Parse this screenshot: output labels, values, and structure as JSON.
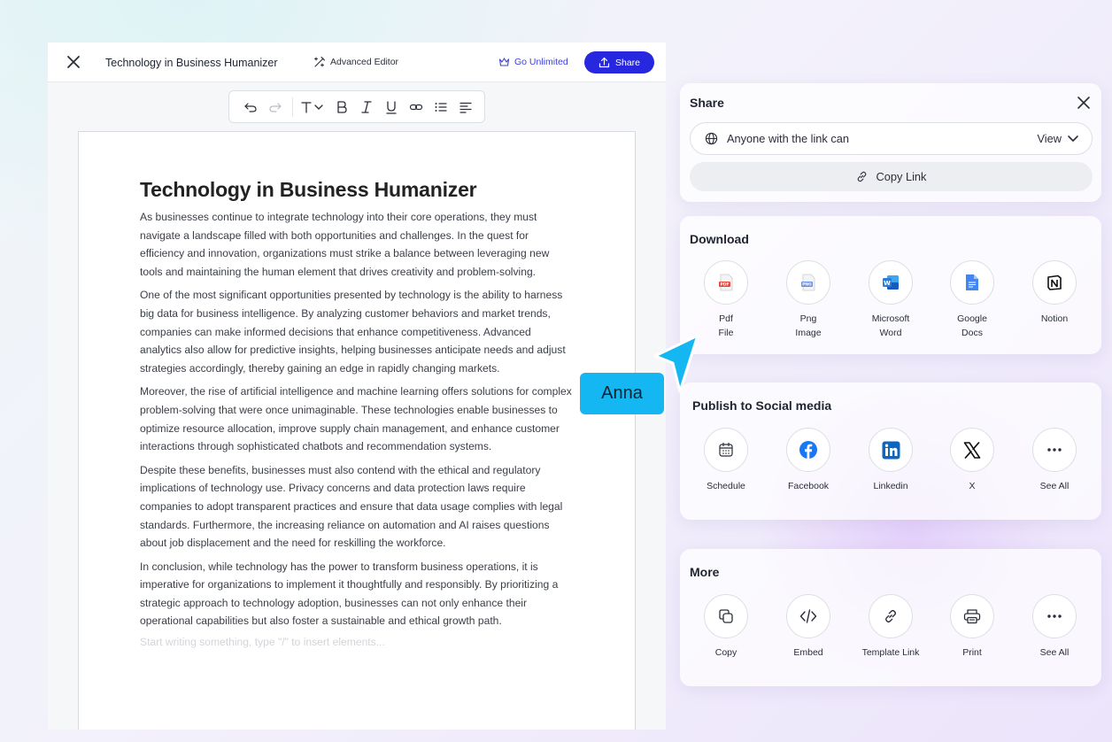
{
  "editor": {
    "doc_name": "Technology in Business Humanizer",
    "advanced_editor_label": "Advanced Editor",
    "go_unlimited_label": "Go Unlimited",
    "share_label": "Share",
    "accent": "#2727e0"
  },
  "toolbar": {
    "icons": [
      "undo-icon",
      "redo-icon",
      "text-style-icon",
      "bold-icon",
      "italic-icon",
      "underline-icon",
      "link-icon",
      "bullet-list-icon",
      "align-left-icon"
    ]
  },
  "document": {
    "title": "Technology in Business Humanizer",
    "paragraphs": [
      "As businesses continue to integrate technology into their core operations, they must navigate a landscape filled with both opportunities and challenges. In the quest for efficiency and innovation, organizations must strike a balance between leveraging new tools and maintaining the human element that drives creativity and problem-solving.",
      "One of the most significant opportunities presented by technology is the ability to harness big data for business intelligence. By analyzing customer behaviors and market trends, companies can make informed decisions that enhance competitiveness. Advanced analytics also allow for predictive insights, helping businesses anticipate needs and adjust strategies accordingly, thereby gaining an edge in rapidly changing markets.",
      "Moreover, the rise of artificial intelligence and machine learning offers solutions for complex problem-solving that were once unimaginable. These technologies enable businesses to optimize resource allocation, improve supply chain management, and enhance customer interactions through sophisticated chatbots and recommendation systems.",
      "Despite these benefits, businesses must also contend with the ethical and regulatory implications of technology use. Privacy concerns and data protection laws require companies to adopt transparent practices and ensure that data usage complies with legal standards. Furthermore, the increasing reliance on automation and AI raises questions about job displacement and the need for reskilling the workforce.",
      "In conclusion, while technology has the power to transform business operations, it is imperative for organizations to implement it thoughtfully and responsibly. By prioritizing a strategic approach to technology adoption, businesses can not only enhance their operational capabilities but also foster a sustainable and ethical growth path."
    ],
    "placeholder": "Start writing something, type \"/\" to insert elements..."
  },
  "share": {
    "title": "Share",
    "access_label": "Anyone with the link can",
    "access_value": "View",
    "copy_link_label": "Copy Link"
  },
  "download": {
    "title": "Download",
    "items": [
      {
        "line1": "Pdf",
        "line2": "File",
        "icon": "pdf-file-icon"
      },
      {
        "line1": "Png",
        "line2": "Image",
        "icon": "png-image-icon"
      },
      {
        "line1": "Microsoft",
        "line2": "Word",
        "icon": "microsoft-word-icon"
      },
      {
        "line1": "Google",
        "line2": "Docs",
        "icon": "google-docs-icon"
      },
      {
        "line1": "Notion",
        "line2": "",
        "icon": "notion-icon"
      }
    ]
  },
  "social": {
    "title": "Publish to Social media",
    "items": [
      {
        "label": "Schedule",
        "icon": "calendar-icon"
      },
      {
        "label": "Facebook",
        "icon": "facebook-icon"
      },
      {
        "label": "Linkedin",
        "icon": "linkedin-icon"
      },
      {
        "label": "X",
        "icon": "x-logo-icon"
      },
      {
        "label": "See All",
        "icon": "more-dots-icon"
      }
    ]
  },
  "more": {
    "title": "More",
    "items": [
      {
        "label": "Copy",
        "icon": "copy-icon"
      },
      {
        "label": "Embed",
        "icon": "embed-code-icon"
      },
      {
        "label": "Template Link",
        "icon": "link-icon"
      },
      {
        "label": "Print",
        "icon": "printer-icon"
      },
      {
        "label": "See All",
        "icon": "more-dots-icon"
      }
    ]
  },
  "collaborator": {
    "name": "Anna",
    "color": "#14b7f2"
  }
}
